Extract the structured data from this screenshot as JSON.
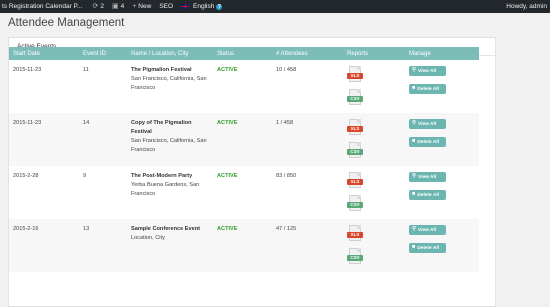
{
  "adminbar": {
    "site_title": "ts Registration Calendar P...",
    "updates_count": "2",
    "comments_count": "4",
    "new_label": "New",
    "seo_label": "SEO",
    "language_label": "English",
    "howdy": "Howdy, admin",
    "icons": [
      "updates-icon",
      "comments-icon",
      "plus-icon",
      "uk-flag-icon",
      "help-icon"
    ]
  },
  "page": {
    "title": "Attendee Management"
  },
  "panel": {
    "title": "Active Events"
  },
  "table": {
    "headers": [
      "Start Date",
      "Event ID",
      "Name / Location, City",
      "Status",
      "# Attendees",
      "Reports",
      "Manage"
    ],
    "rows": [
      {
        "date": "2015-11-23",
        "id": "11",
        "name": "The Pigmalion Festival",
        "location": "San Francisco, California, San Francisco",
        "status": "ACTIVE",
        "attendees": "10 / 458"
      },
      {
        "date": "2015-11-23",
        "id": "14",
        "name": "Copy of The Pigmalion Festival",
        "location": "San Francisco, California, San Francisco",
        "status": "ACTIVE",
        "attendees": "1 / 458"
      },
      {
        "date": "2015-2-28",
        "id": "9",
        "name": "The Post-Modern Party",
        "location": "Yerba Buena Gardens, San Francisco",
        "status": "ACTIVE",
        "attendees": "83 / 850"
      },
      {
        "date": "2015-2-16",
        "id": "13",
        "name": "Sample Conference Event",
        "location": "Location, City",
        "status": "ACTIVE",
        "attendees": "47 / 125"
      }
    ],
    "report_labels": {
      "xls": "XLS",
      "csv": "CSV"
    },
    "manage_labels": {
      "view_all": "View All",
      "delete_all": "Delete All"
    }
  },
  "colors": {
    "adminbar_bg": "#23282d",
    "header_bg": "#7cbdb8",
    "button_bg": "#6cb6b1",
    "status_active": "#2e9e2e",
    "xls": "#d9472b",
    "csv": "#5aa777"
  }
}
